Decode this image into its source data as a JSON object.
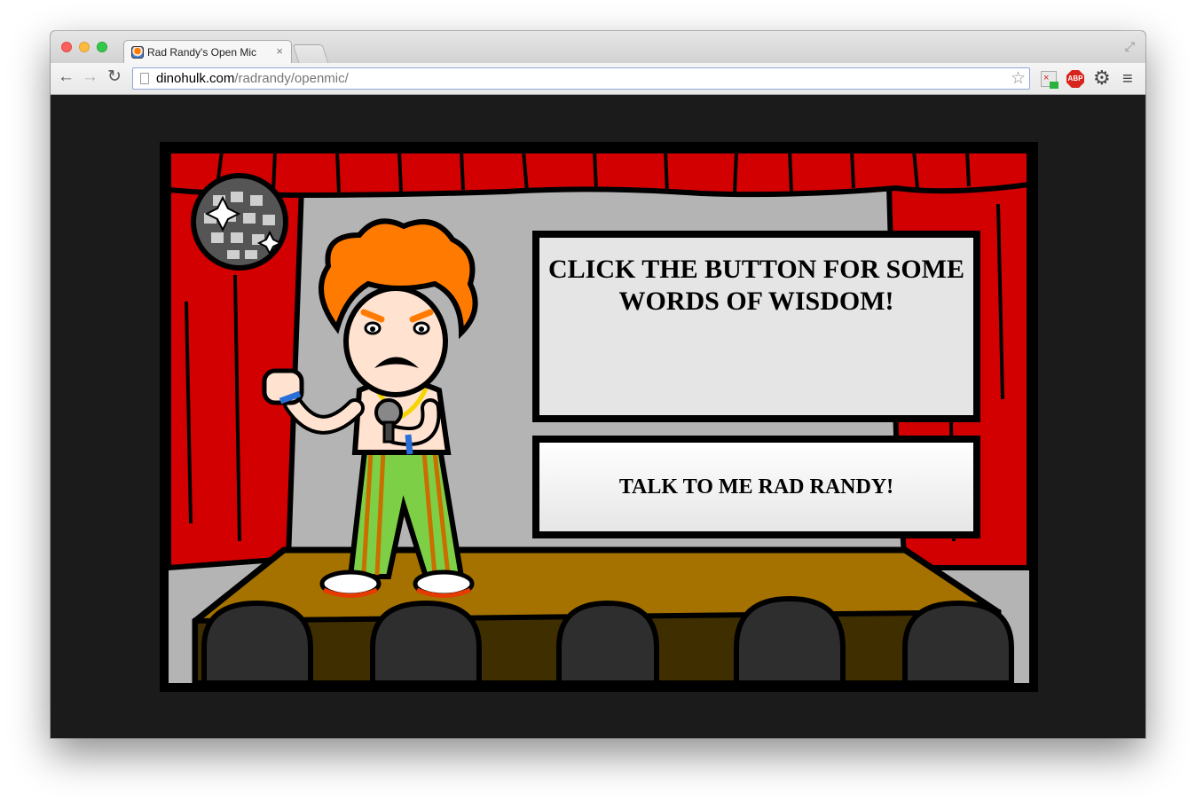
{
  "browser": {
    "tab_title": "Rad Randy's Open Mic",
    "tab_close": "×",
    "url_host": "dinohulk.com",
    "url_path": "/radrandy/openmic/"
  },
  "page": {
    "wisdom_prompt": "CLICK THE BUTTON FOR SOME WORDS OF WISDOM!",
    "talk_button_label": "TALK TO ME RAD RANDY!"
  },
  "colors": {
    "curtain": "#d20000",
    "stage_floor": "#a57200",
    "backdrop": "#b4b4b4",
    "hair": "#ff7a00",
    "background": "#1b1b1b"
  },
  "icons": {
    "back": "back-arrow-icon",
    "forward": "forward-arrow-icon",
    "reload": "reload-icon",
    "bookmark": "star-icon",
    "settings": "gear-icon",
    "menu": "hamburger-menu-icon"
  }
}
